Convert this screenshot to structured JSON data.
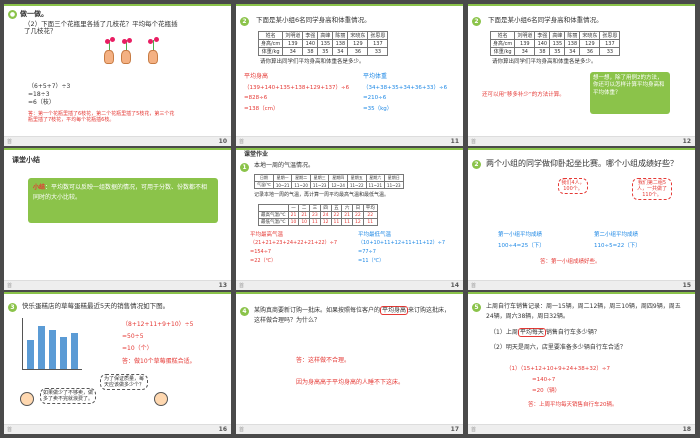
{
  "slides": {
    "s10": {
      "num": "10",
      "title": "做一做。",
      "question": "（2）下面三个花瓶里各插了几枝花？平均每个花瓶插了几枝花？",
      "calc": [
        "（6+5+7）÷3",
        "=18÷3",
        "=6（枝）"
      ],
      "answer": "答：第一个花瓶里插了6枝花，第二个花瓶里插了5枝花，第三个花瓶里插了7枝花，平均每个花瓶插6枝。"
    },
    "s11": {
      "num": "11",
      "badge": "2",
      "title": "下面是某小组6名同学身高和体重情况。",
      "table": {
        "header": [
          "姓名",
          "刘明道",
          "李强",
          "高峰",
          "陈丽",
          "宋晓东",
          "张思恩"
        ],
        "rows": [
          [
            "身高/cm",
            "139",
            "140",
            "135",
            "138",
            "129",
            "137"
          ],
          [
            "体重/kg",
            "34",
            "38",
            "35",
            "34",
            "36",
            "33"
          ]
        ]
      },
      "prompt": "请你算出同学们平均身高和体重各是多少。",
      "left_head": "平均身高",
      "left_lines": [
        "（139+140+135+138+129+137）÷6",
        "=828÷6",
        "=138（cm）"
      ],
      "right_head": "平均体重",
      "right_lines": [
        "（34+38+35+34+36+33）÷6",
        "=210÷6",
        "=35（kg）"
      ]
    },
    "s12": {
      "num": "12",
      "badge": "2",
      "title": "下面是某小组6名同学身高和体重情况。",
      "prompt": "请你算出同学们平均身高和体重各是多少。",
      "think": "想一想，除了用例2的方法，你还可以怎样计算平均身高和平均体重？",
      "hint": "还可以用“移多补少”的方法计算。"
    },
    "s13": {
      "num": "13",
      "title": "课堂小结",
      "summary_head": "小结",
      "summary": "：平均数可以反映一组数据的情况，可用于分数、份数都不相同时的大小比较。"
    },
    "s14": {
      "num": "14",
      "title": "课堂作业",
      "badge": "1",
      "q": "本地一周的气温情况。",
      "table_head": [
        "日期",
        "星期一",
        "星期二",
        "星期三",
        "星期四",
        "星期五",
        "星期六",
        "星期日"
      ],
      "table_row": [
        "气温/℃",
        "10~21",
        "11~20",
        "11~23",
        "12~24",
        "11~22",
        "11~21",
        "11~23"
      ],
      "ask": "记录本地一周的气温，再计算一周平均最高气温和最低气温。",
      "grid_head": [
        "",
        "一",
        "二",
        "三",
        "四",
        "五",
        "六",
        "日",
        "平均"
      ],
      "grid_high": [
        "最高气温/℃",
        "21",
        "21",
        "23",
        "24",
        "22",
        "21",
        "22",
        "22"
      ],
      "grid_low": [
        "最低气温/℃",
        "10",
        "10",
        "11",
        "12",
        "11",
        "11",
        "12",
        "11"
      ],
      "left_head": "平均最高气温",
      "left_lines": [
        "（21+21+23+24+22+21+22）÷7",
        "=154÷7",
        "=22（℃）"
      ],
      "right_head": "平均最低气温",
      "right_lines": [
        "（10+10+11+12+11+11+12）÷7",
        "=77÷7",
        "=11（℃）"
      ]
    },
    "s15": {
      "num": "15",
      "badge": "2",
      "title": "两个小组的同学做仰卧起坐比赛。哪个小组成绩好些？",
      "bubble1": "我们4人，100个。",
      "bubble2": "我们第二组5人，一共做了110个。",
      "left_head": "第一小组平均成绩",
      "left_calc": "100÷4=25（下）",
      "right_head": "第二小组平均成绩",
      "right_calc": "110÷5=22（下）",
      "answer": "答：第一小组成绩好些。"
    },
    "s16": {
      "num": "16",
      "badge": "3",
      "title": "快乐蛋糕店的草莓蛋糕最近5天的销售情况如下图。",
      "bars": [
        8,
        12,
        11,
        9,
        10
      ],
      "calc": [
        "（8+12+11+9+10）÷5",
        "=50÷5",
        "=10（个）"
      ],
      "answer": "答：做10个草莓蛋糕合适。",
      "speech1": "为了保证质量，每天应该做多少个？",
      "speech2": "如果做少了不够卖，做多了卖不完就浪费了。"
    },
    "s17": {
      "num": "17",
      "badge": "4",
      "question_a": "某购真商要新订购一批床。如果按照每位客户的",
      "question_hl": "平均身高",
      "question_b": "来订购这批床，这样做合理吗？为什么？",
      "answer1": "答：这样做不合理。",
      "answer2": "因为身高高于平均身高的人睡不下这床。"
    },
    "s18": {
      "num": "18",
      "badge": "5",
      "intro": "上周自行车销售记录：周一15辆，周二12辆，周三10辆，周四9辆，周五24辆，周六38辆，周日32辆。",
      "q1_a": "（1）上周",
      "q1_hl": "平均每天",
      "q1_b": "销售自行车多少辆？",
      "q2": "（2）明天是周六，店里要准备多少辆自行车合适？",
      "calc": [
        "（1）（15+12+10+9+24+38+32）÷7",
        "=140÷7",
        "=20（辆）"
      ],
      "answer": "答：上周平均每天销售自行车20辆。"
    }
  },
  "footer_label": "首"
}
